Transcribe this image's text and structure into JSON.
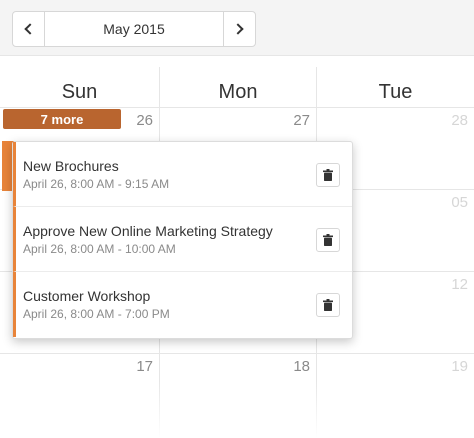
{
  "navigation": {
    "prev_icon": "chevron-left-icon",
    "title": "May 2015",
    "next_icon": "chevron-right-icon"
  },
  "calendar": {
    "day_headers": [
      "Sun",
      "Mon",
      "Tue"
    ],
    "week1": [
      "26",
      "27",
      "28"
    ],
    "week2": [
      "",
      "",
      "05"
    ],
    "week3": [
      "",
      "",
      "12"
    ],
    "week4": [
      "17",
      "18",
      "19"
    ]
  },
  "more_badge": {
    "label": "7 more"
  },
  "popup": {
    "items": [
      {
        "title": "New Brochures",
        "time": "April 26, 8:00 AM - 9:15 AM",
        "delete_icon": "trash-icon"
      },
      {
        "title": "Approve New Online Marketing Strategy",
        "time": "April 26, 8:00 AM - 10:00 AM",
        "delete_icon": "trash-icon"
      },
      {
        "title": "Customer Workshop",
        "time": "April 26, 8:00 AM - 7:00 PM",
        "delete_icon": "trash-icon"
      }
    ]
  },
  "colors": {
    "accent": "#e8843a",
    "more_badge": "#b9652f"
  }
}
